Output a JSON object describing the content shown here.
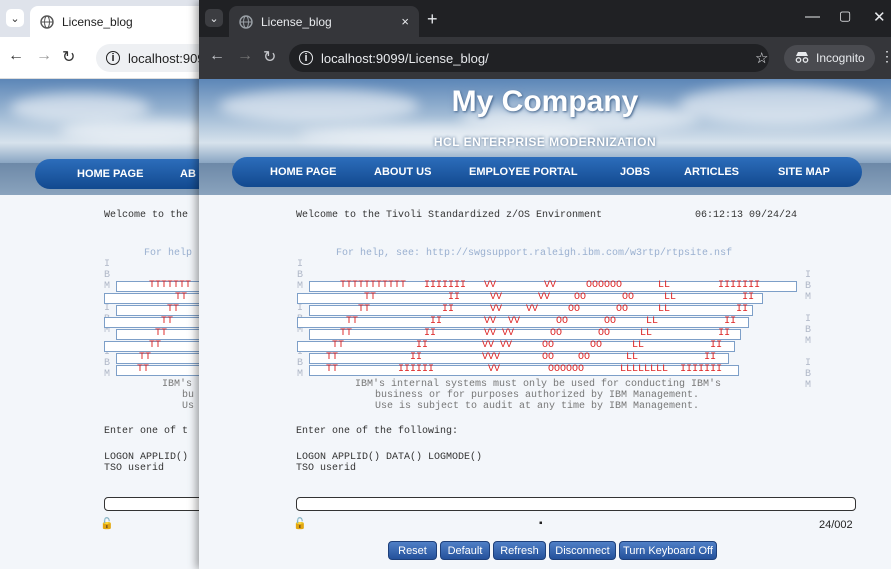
{
  "back_window": {
    "tab_title": "License_blog",
    "url": "localhost:909",
    "nav": {
      "home": "HOME PAGE",
      "about": "AB"
    },
    "terminal": {
      "welcome": "Welcome to the",
      "help": "For help",
      "enter": "Enter one of t",
      "logon": "LOGON APPLID()",
      "tso": "TSO userid",
      "ibm": "IBM's",
      "bu": "bu",
      "us": "Us"
    }
  },
  "front_window": {
    "tab_title": "License_blog",
    "tab_close": "×",
    "new_tab": "+",
    "url": "localhost:9099/License_blog/",
    "incognito_label": "Incognito",
    "company": "My Company",
    "subtitle": "HCL ENTERPRISE MODERNIZATION",
    "nav": [
      "HOME PAGE",
      "ABOUT US",
      "EMPLOYEE PORTAL",
      "JOBS",
      "ARTICLES",
      "SITE MAP"
    ],
    "terminal": {
      "welcome": "Welcome to the Tivoli Standardized z/OS Environment",
      "time": "06:12:13 09/24/24",
      "help": "For help, see: http://swgsupport.raleigh.ibm.com/w3rtp/rtpsite.nsf",
      "art": [
        "TTTTTTTTTTT   IIIIIII   VV        VV     OOOOOO      LL        IIIIIII",
        "     TT            II     VV      VV    OO      OO     LL           II",
        "     TT            II      VV    VV     OO      OO     LL           II",
        "     TT            II       VV  VV      OO      OO     LL           II",
        "     TT            II        VV VV      OO      OO     LL           II",
        "     TT            II         VV VV     OO      OO     LL           II",
        "     TT            II          VVV       OO    OO      LL           II",
        "     TT          IIIIII         VV        OOOOOO      LLLLLLLL  IIIIIII"
      ],
      "left_letters": [
        "I",
        "B",
        "M",
        "",
        "I",
        "B",
        "M",
        "",
        "I",
        "B",
        "M"
      ],
      "right_letters": [
        "I",
        "B",
        "M",
        "",
        "I",
        "B",
        "M",
        "",
        "I",
        "B",
        "M"
      ],
      "notice": [
        "IBM's internal systems must only be used for conducting IBM's",
        "business or for purposes authorized by IBM Management.",
        "Use is subject to audit at any time by IBM Management."
      ],
      "enter": "Enter one of the following:",
      "logon": "LOGON APPLID() DATA() LOGMODE()",
      "tso": "TSO userid",
      "cursor_pos": "24/002"
    },
    "buttons": [
      "Reset",
      "Default",
      "Refresh",
      "Disconnect",
      "Turn Keyboard Off"
    ]
  },
  "colors": {
    "accent": "#1f5fa8",
    "terminal_red": "#dd2222",
    "chrome_dark": "#202124"
  }
}
